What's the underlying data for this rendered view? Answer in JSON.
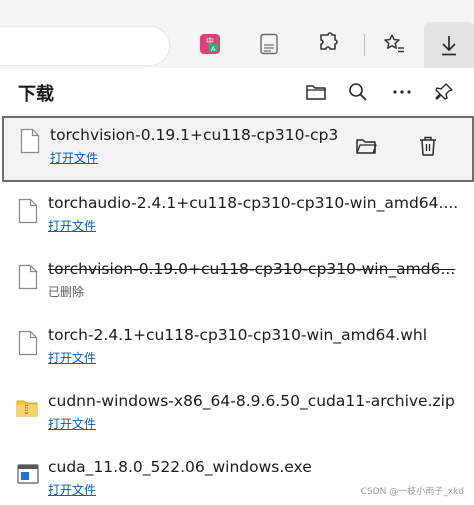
{
  "toolbar": {
    "icons": [
      "translate-icon",
      "reading-view-icon",
      "extensions-icon",
      "favorites-icon",
      "downloads-icon"
    ],
    "accent_translate": "#e0407a"
  },
  "downloads": {
    "title": "下载",
    "header_icons": [
      "open-folder-icon",
      "search-icon",
      "more-icon",
      "pin-icon"
    ],
    "items": [
      {
        "name": "torchvision-0.19.1+cu118-cp310-cp3",
        "action": "打开文件",
        "state": "completed",
        "icon": "file-icon"
      },
      {
        "name": "torchaudio-2.4.1+cu118-cp310-cp310-win_amd64....",
        "action": "打开文件",
        "state": "completed",
        "icon": "file-icon"
      },
      {
        "name": "torchvision-0.19.0+cu118-cp310-cp310-win_amd6...",
        "action": "已删除",
        "state": "deleted",
        "icon": "file-icon"
      },
      {
        "name": "torch-2.4.1+cu118-cp310-cp310-win_amd64.whl",
        "action": "打开文件",
        "state": "completed",
        "icon": "file-icon"
      },
      {
        "name": "cudnn-windows-x86_64-8.9.6.50_cuda11-archive.zip",
        "action": "打开文件",
        "state": "completed",
        "icon": "zip-folder-icon"
      },
      {
        "name": "cuda_11.8.0_522.06_windows.exe",
        "action": "打开文件",
        "state": "completed",
        "icon": "exe-icon"
      }
    ],
    "link_color": "#005fb8"
  },
  "watermark": "CSDN @一枝小雨子_xkd"
}
